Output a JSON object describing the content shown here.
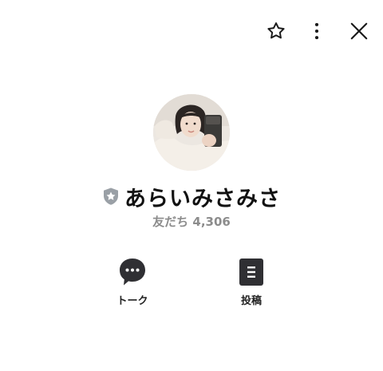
{
  "header": {
    "icons": [
      "star-icon",
      "more-vertical-icon",
      "close-icon"
    ]
  },
  "profile": {
    "name": "あらいみさみさ",
    "friends_text": "友だち 4,306",
    "badge_icon": "shield-star-icon"
  },
  "actions": [
    {
      "label": "トーク",
      "icon": "chat-bubble-icon"
    },
    {
      "label": "投稿",
      "icon": "post-icon"
    }
  ],
  "colors": {
    "icon": "#1a1a1a",
    "badge": "#9aa0a6",
    "subtext": "#8c8c8c",
    "action_icon": "#2f2f33"
  }
}
